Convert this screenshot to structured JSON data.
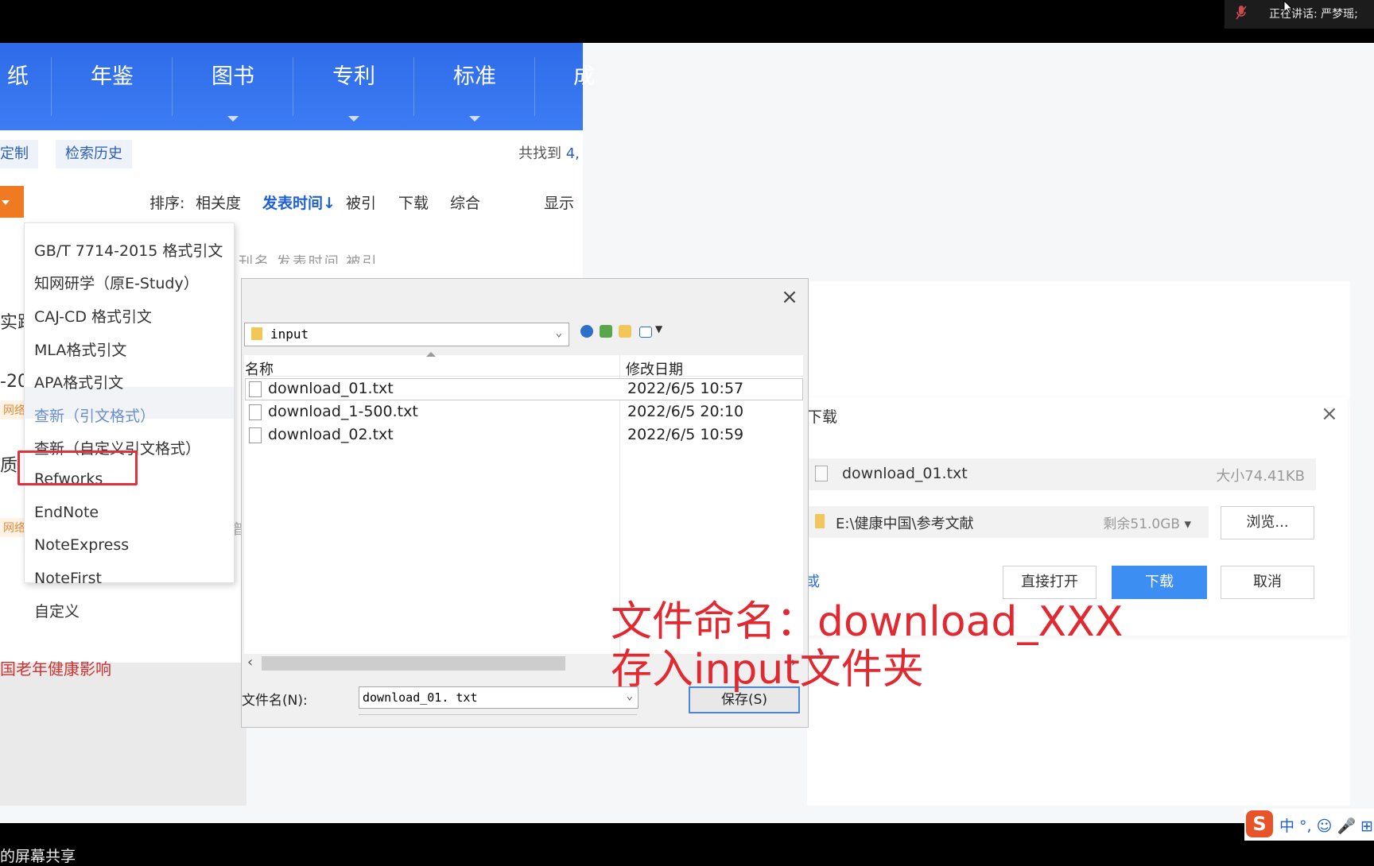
{
  "meeting": {
    "speaking_label": "正在讲话: 严梦瑶;",
    "share_text": "的屏幕共享"
  },
  "cnki": {
    "nav_tabs": [
      {
        "label": "纸"
      },
      {
        "label": "年鉴"
      },
      {
        "label": "图书"
      },
      {
        "label": "专利"
      },
      {
        "label": "标准"
      },
      {
        "label": "成"
      }
    ],
    "custom_label": "定制",
    "history_label": "检索历史",
    "found_prefix": "共找到",
    "found_count": "4,",
    "sort": {
      "label": "排序:",
      "relevance": "相关度",
      "publish_time": "发表时间↓",
      "cited": "被引",
      "download": "下载",
      "overall": "综合",
      "display": "显示"
    },
    "column_header_fragment": "刊名    发表时间  被引",
    "fragments": {
      "f1": "实践",
      "f2": "-20",
      "f3": "网络",
      "f4": "质",
      "f5": "网络",
      "f6": "普"
    },
    "bottom_text": "国老年健康影响"
  },
  "export_menu": {
    "items": [
      {
        "label": "GB/T 7714-2015 格式引文"
      },
      {
        "label": "知网研学（原E-Study）"
      },
      {
        "label": "CAJ-CD 格式引文"
      },
      {
        "label": "MLA格式引文"
      },
      {
        "label": "APA格式引文"
      },
      {
        "label": "查新（引文格式）"
      },
      {
        "label": "查新（自定义引文格式）"
      },
      {
        "label": "Refworks"
      },
      {
        "label": "EndNote"
      },
      {
        "label": "NoteExpress"
      },
      {
        "label": "NoteFirst"
      },
      {
        "label": "自定义"
      }
    ]
  },
  "save_dialog": {
    "close": "×",
    "path": "input",
    "col_name": "名称",
    "col_date": "修改日期",
    "files": [
      {
        "name": "download_01.txt",
        "date": "2022/6/5 10:57"
      },
      {
        "name": "download_1-500.txt",
        "date": "2022/6/5 20:10"
      },
      {
        "name": "download_02.txt",
        "date": "2022/6/5 10:59"
      }
    ],
    "filename_label": "文件名(N):",
    "filename_value": "download_01. txt",
    "save_button": "保存(S)"
  },
  "download_panel": {
    "title": "下载",
    "close": "×",
    "file_name": "download_01.txt",
    "file_size": "大小74.41KB",
    "path": "E:\\健康中国\\参考文献",
    "free_space": "剩余51.0GB",
    "browse": "浏览...",
    "link_fragment": "或",
    "open_direct": "直接打开",
    "download": "下载",
    "cancel": "取消"
  },
  "annotation": {
    "line1": "文件命名：download_XXX",
    "line2": "存入input文件夹"
  },
  "ime": {
    "logo": "S",
    "text": "中 °, ☺ 🎤 ⊞"
  },
  "colors": {
    "cnki_blue": "#3c7cf3",
    "annotation_red": "#e22830",
    "highlight_box": "#e3303c",
    "download_button": "#3d8ef3"
  }
}
